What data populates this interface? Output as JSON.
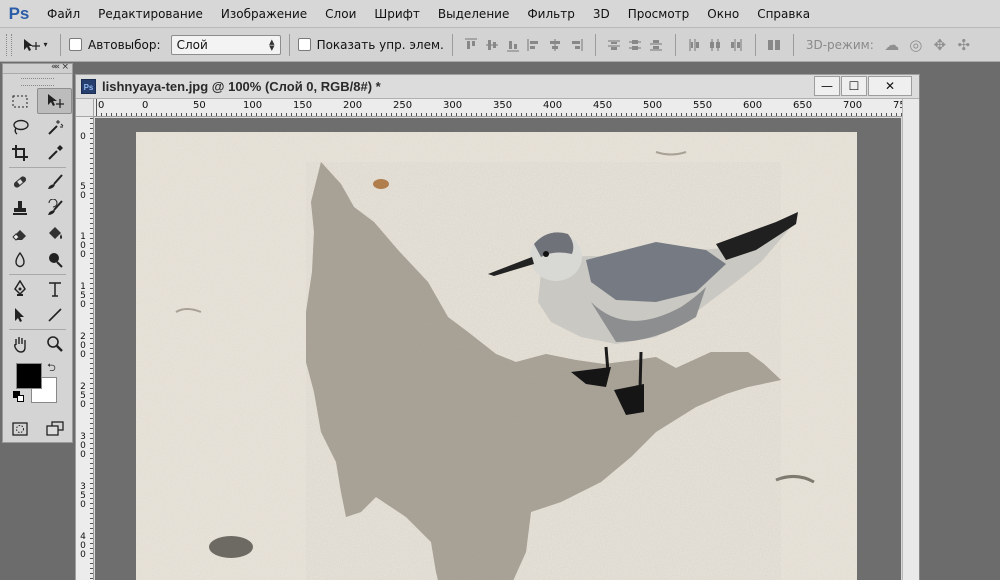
{
  "app": {
    "logo": "Ps",
    "menu": [
      "Файл",
      "Редактирование",
      "Изображение",
      "Слои",
      "Шрифт",
      "Выделение",
      "Фильтр",
      "3D",
      "Просмотр",
      "Окно",
      "Справка"
    ]
  },
  "options_bar": {
    "autoselect_label": "Автовыбор:",
    "autoselect_value": "Слой",
    "show_transform_label": "Показать упр. элем.",
    "mode_3d_label": "3D-режим:"
  },
  "toolbox": {
    "collapse": "««",
    "close": "×",
    "tools": [
      [
        "rect-marquee-icon",
        "move-icon"
      ],
      [
        "lasso-icon",
        "magic-wand-icon"
      ],
      [
        "crop-icon",
        "eyedropper-icon"
      ],
      [
        "healing-brush-icon",
        "brush-icon"
      ],
      [
        "clone-stamp-icon",
        "history-brush-icon"
      ],
      [
        "eraser-icon",
        "paint-bucket-icon"
      ],
      [
        "blur-icon",
        "dodge-icon"
      ],
      [
        "pen-icon",
        "type-icon"
      ],
      [
        "path-select-icon",
        "line-icon"
      ],
      [
        "hand-icon",
        "zoom-icon"
      ]
    ],
    "foreground_color": "#000000",
    "background_color": "#ffffff"
  },
  "document": {
    "title": "lishnyaya-ten.jpg @ 100% (Слой 0, RGB/8#) *",
    "controls": {
      "minimize": "—",
      "maximize": "☐",
      "close": "✕"
    },
    "ruler_h_labels": [
      "0",
      "0",
      "50",
      "100",
      "150",
      "200",
      "250",
      "300",
      "350",
      "400",
      "450",
      "500",
      "550",
      "600",
      "650",
      "700",
      "75"
    ],
    "ruler_v_labels": [
      "0",
      "5\n0",
      "1\n0\n0",
      "1\n5\n0",
      "2\n0\n0",
      "2\n5\n0",
      "3\n0\n0",
      "3\n5\n0",
      "4\n0\n0"
    ]
  },
  "colors": {
    "menubar_bg": "#d7d7d7",
    "workspace_bg": "#6c6c6c",
    "ps_blue": "#2b5ca8"
  }
}
